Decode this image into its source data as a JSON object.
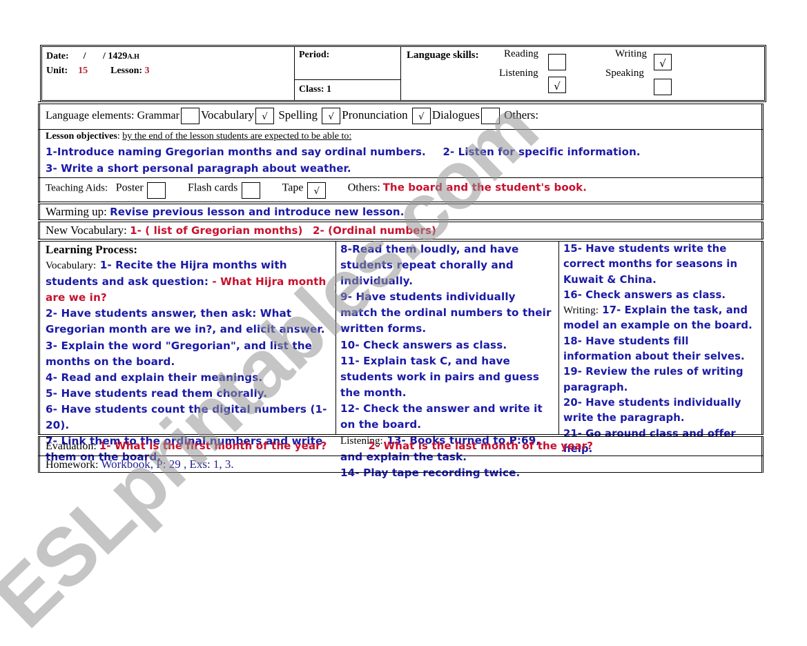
{
  "header": {
    "date_label": "Date:",
    "date_value": "/ / 1429",
    "date_suffix": "A.H",
    "unit_label": "Unit:",
    "unit_value": "15",
    "lesson_label": "Lesson:",
    "lesson_value": "3",
    "period_label": "Period:",
    "class_label": "Class: 1",
    "skills_label": "Language skills:",
    "skills": [
      {
        "label": "Reading",
        "checked": false,
        "mark": ""
      },
      {
        "label": "Listening",
        "checked": true,
        "mark": "√"
      },
      {
        "label": "Writing",
        "checked": true,
        "mark": "√"
      },
      {
        "label": "Speaking",
        "checked": false,
        "mark": ""
      }
    ]
  },
  "language_elements": {
    "label": "Language elements:",
    "items": [
      {
        "label": "Grammar",
        "checked": false,
        "mark": ""
      },
      {
        "label": "Vocabulary",
        "checked": true,
        "mark": "√"
      },
      {
        "label": "Spelling",
        "checked": true,
        "mark": "√"
      },
      {
        "label": "Pronunciation",
        "checked": true,
        "mark": "√"
      },
      {
        "label": "Dialogues",
        "checked": false,
        "mark": ""
      }
    ],
    "others_label": "Others:"
  },
  "objectives": {
    "label": "Lesson objectives",
    "intro": "by the end of the lesson students are expected to be able to:",
    "item1": "1-Introduce naming Gregorian months and say ordinal numbers.",
    "item2": "2- Listen for specific information.",
    "item3": "3- Write a short personal paragraph about weather."
  },
  "teaching_aids": {
    "label": "Teaching Aids:",
    "items": [
      {
        "label": "Poster",
        "checked": false,
        "mark": ""
      },
      {
        "label": "Flash cards",
        "checked": false,
        "mark": ""
      },
      {
        "label": "Tape",
        "checked": true,
        "mark": "√"
      }
    ],
    "others_label": "Others:",
    "others_value": "The board and the student's book."
  },
  "warming_up": {
    "label": "Warming up:",
    "value": "Revise previous lesson and introduce new lesson."
  },
  "new_vocabulary": {
    "label": "New Vocabulary:",
    "item1": "1- ( list of Gregorian months)",
    "item2": "2- (Ordinal numbers)"
  },
  "learning_process": {
    "heading": "Learning Process:",
    "vocab_label": "Vocabulary:",
    "col1": {
      "s1": "1- Recite the Hijra months with students and ask question:",
      "s1_q": "- What Hijra month are we in?",
      "s2": "2- Have students answer, then ask: What Gregorian month are we in?, and elicit answer.",
      "s3": "3- Explain the word \"Gregorian\", and list the months on the board.",
      "s4": "4- Read and explain their meanings.",
      "s5": "5- Have students read them chorally.",
      "s6": "6- Have students count the digital numbers (1- 20).",
      "s7": "7- Link them to the ordinal numbers and write them on the board."
    },
    "col2": {
      "s8": "8-Read them loudly, and have students repeat chorally and individually.",
      "s9": "9- Have students individually match the ordinal numbers to their written forms.",
      "s10": "10- Check answers as class.",
      "s11": "11- Explain task C, and have students work in pairs and guess the month.",
      "s12": "12- Check the answer and write it on the board.",
      "listening_label": "Listening:",
      "s13": "13- Books turned to P:69, and explain the task.",
      "s14": "14- Play tape recording twice."
    },
    "col3": {
      "s15": "15- Have students write the correct months for seasons in Kuwait & China.",
      "s16": "16- Check answers as class.",
      "writing_label": "Writing:",
      "s17": "17- Explain the task, and model an example on the board.",
      "s18": "18- Have students fill information about their selves.",
      "s19": "19- Review the rules of writing paragraph.",
      "s20": "20- Have students individually write the paragraph.",
      "s21": "21- Go around class and offer help."
    }
  },
  "evaluation": {
    "label": "Evaluation:",
    "q1": "1- What is the first month of the year?",
    "q2": "2- What is the last month of the year?"
  },
  "homework": {
    "label": "Homework:",
    "value": "Workbook, P: 29 , Exs: 1, 3."
  },
  "watermark": "ESLprintables.com",
  "colors": {
    "text_blue": "#1a1aa6",
    "text_red": "#c8102e",
    "watermark_gray": "#969696"
  }
}
